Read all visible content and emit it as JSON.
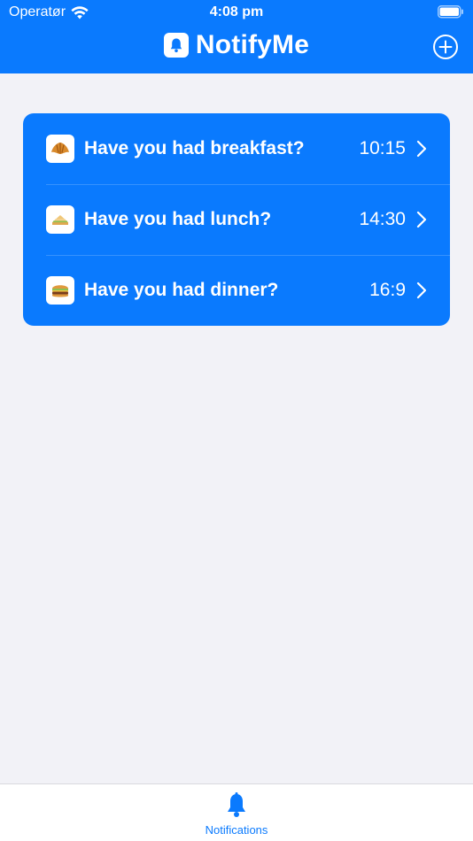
{
  "status_bar": {
    "carrier": "Operatør",
    "time": "4:08 pm"
  },
  "header": {
    "title": "NotifyMe",
    "logo_icon": "bell-icon",
    "add_icon": "plus-circle-icon"
  },
  "reminders": [
    {
      "emoji": "🥐",
      "label": "Have you had breakfast?",
      "time": "10:15"
    },
    {
      "emoji": "🥪",
      "label": "Have you had lunch?",
      "time": "14:30"
    },
    {
      "emoji": "🍔",
      "label": "Have you had dinner?",
      "time": "16:9"
    }
  ],
  "tabbar": {
    "tabs": [
      {
        "label": "Notifications",
        "icon": "bell-icon",
        "selected": true
      }
    ]
  },
  "colors": {
    "accent": "#0a7afe",
    "background": "#f2f2f7",
    "tabbar": "#ffffff"
  }
}
